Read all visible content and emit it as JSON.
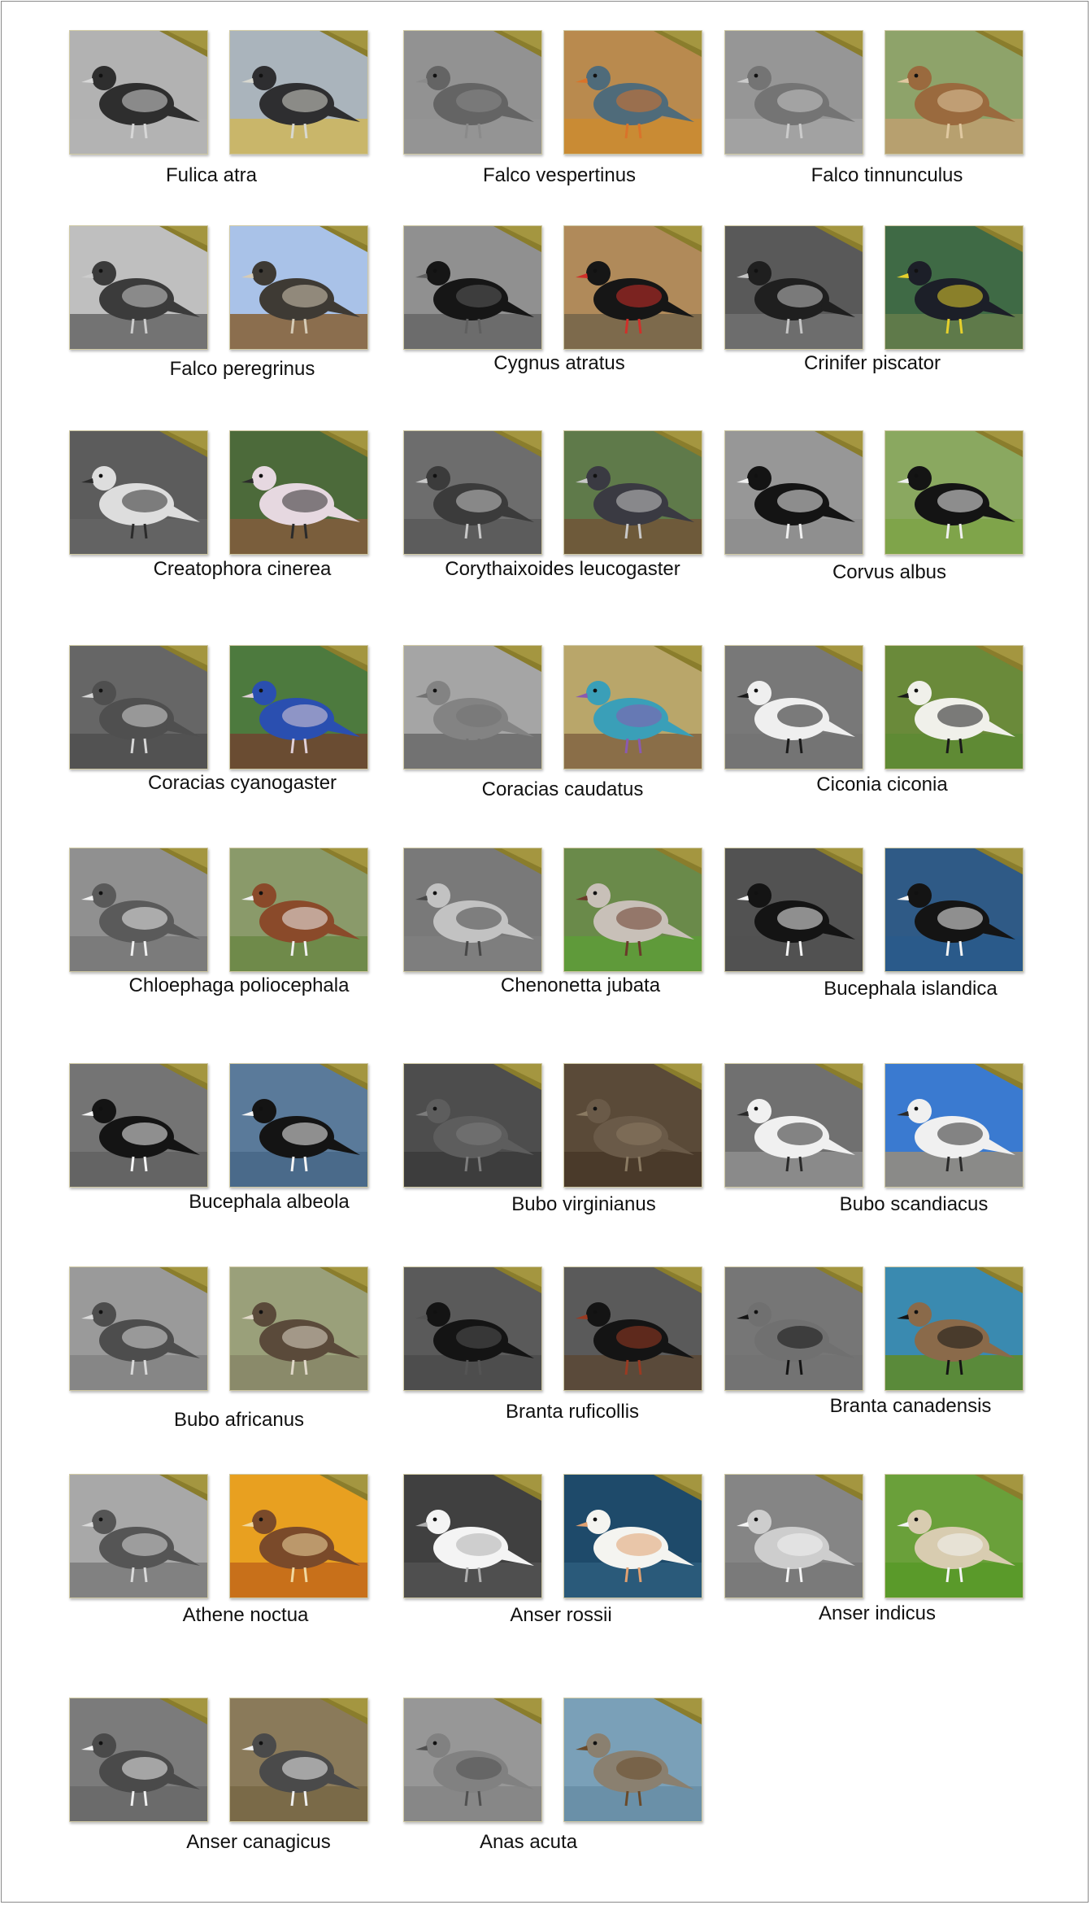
{
  "species": [
    "Fulica atra",
    "Falco vespertinus",
    "Falco tinnunculus",
    "Falco peregrinus",
    "Cygnus atratus",
    "Crinifer piscator",
    "Creatophora cinerea",
    "Corythaixoides leucogaster",
    "Corvus albus",
    "Coracias cyanogaster",
    "Coracias caudatus",
    "Ciconia ciconia",
    "Chloephaga poliocephala",
    "Chenonetta jubata",
    "Bucephala islandica",
    "Bucephala albeola",
    "Bubo virginianus",
    "Bubo scandiacus",
    "Bubo africanus",
    "Branta ruficollis",
    "Branta canadensis",
    "Athene noctua",
    "Anser rossii",
    "Anser indicus",
    "Anser canagicus",
    "Anas acuta"
  ],
  "colors": {
    "corner_ribbon": "#8a7d2c",
    "frame_border": "#cfc9a4",
    "caption_text": "#111111"
  }
}
